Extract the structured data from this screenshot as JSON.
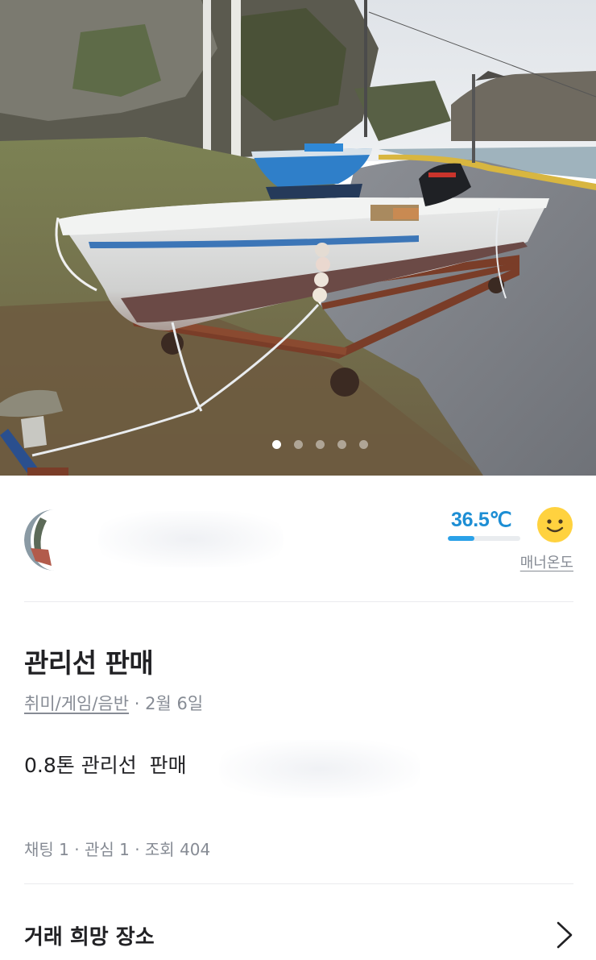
{
  "photo": {
    "image_count": 5,
    "active_index": 0,
    "icon": "boat-photo"
  },
  "seller": {
    "avatar_icon": "profile-avatar",
    "temperature": "36.5℃",
    "temperature_fill": 0.365,
    "temperature_color": "#1d8ed4",
    "face_icon": "smile-face-icon",
    "manner_label": "매너온도"
  },
  "post": {
    "title": "관리선 판매",
    "category": "취미/게임/음반",
    "date_separator": " · ",
    "date": "2월 6일",
    "description": "0.8톤 관리선  판매",
    "stats": "채팅 1 · 관심 1 · 조회 404"
  },
  "location": {
    "label": "거래 희망 장소",
    "icon": "chevron-right-icon"
  }
}
